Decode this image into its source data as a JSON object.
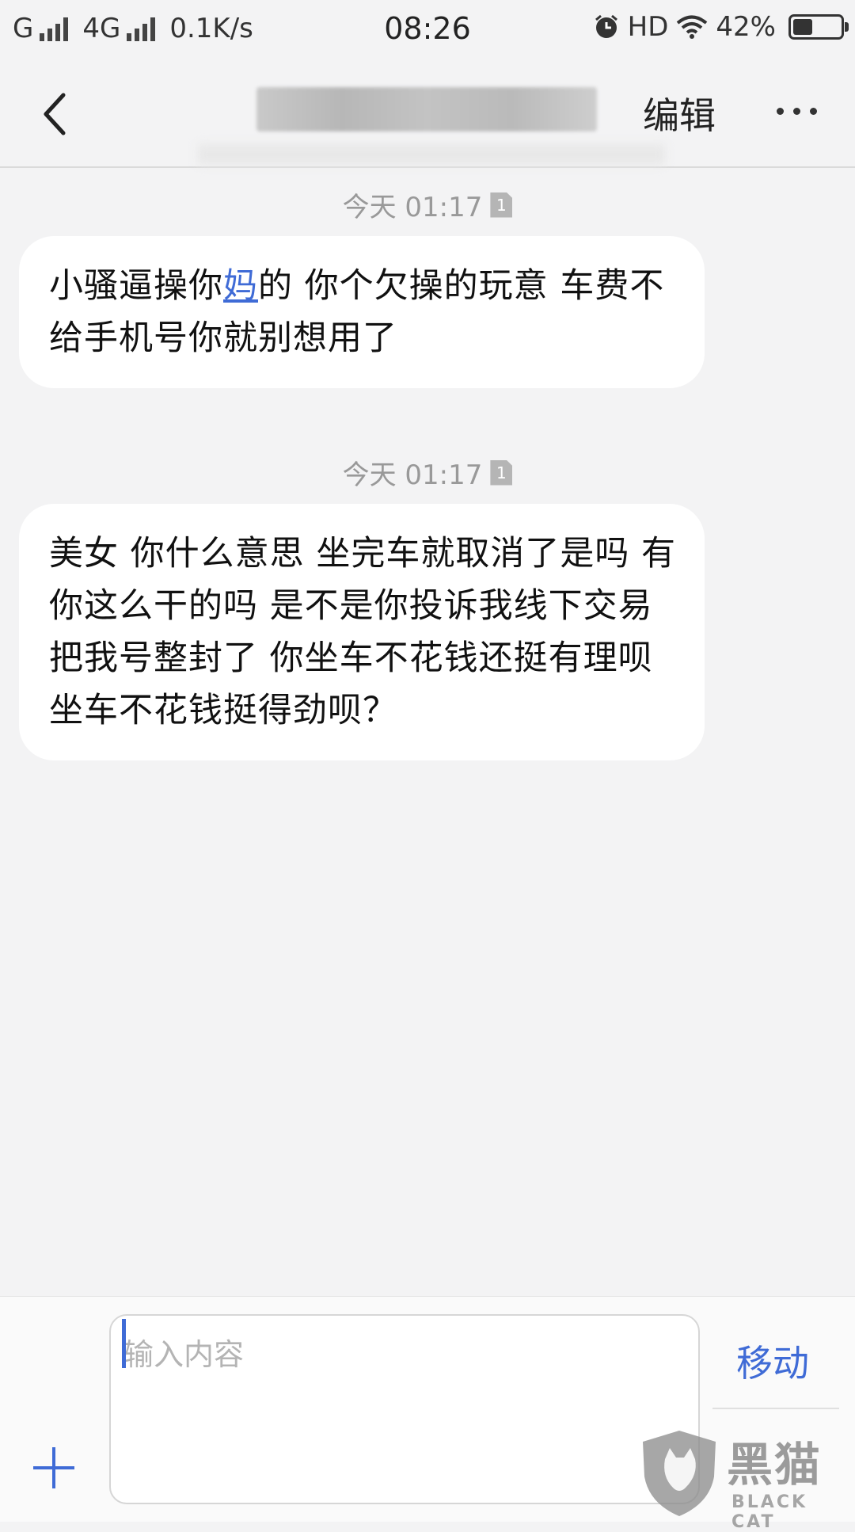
{
  "status_bar": {
    "carrier1": "G",
    "carrier2": "4G",
    "net_speed": "0.1K/s",
    "time": "08:26",
    "hd_label": "HD",
    "battery_percent": "42%",
    "battery_level": 0.42,
    "icons": [
      "signal-icon",
      "alarm-icon",
      "wifi-icon",
      "battery-icon"
    ]
  },
  "header": {
    "back_icon": "chevron-left-icon",
    "edit_label": "编辑",
    "more_icon": "more-horizontal-icon"
  },
  "messages": [
    {
      "timestamp": "今天 01:17",
      "sim": "1",
      "text_before": "小骚逼操你",
      "link_text": "妈",
      "text_after": "的  你个欠操的玩意 车费不给手机号你就别想用了"
    },
    {
      "timestamp": "今天 01:17",
      "sim": "1",
      "text": "美女 你什么意思 坐完车就取消了是吗  有你这么干的吗 是不是你投诉我线下交易把我号整封了  你坐车不花钱还挺有理呗  坐车不花钱挺得劲呗？"
    }
  ],
  "composer": {
    "placeholder": "输入内容",
    "value": "",
    "move_label": "移动",
    "add_icon": "plus-icon"
  },
  "watermark": {
    "cn": "黑猫",
    "en": "BLACK CAT"
  },
  "colors": {
    "accent": "#3f6bd6",
    "background": "#f3f3f4",
    "bubble": "#ffffff",
    "timestamp": "#999999"
  }
}
